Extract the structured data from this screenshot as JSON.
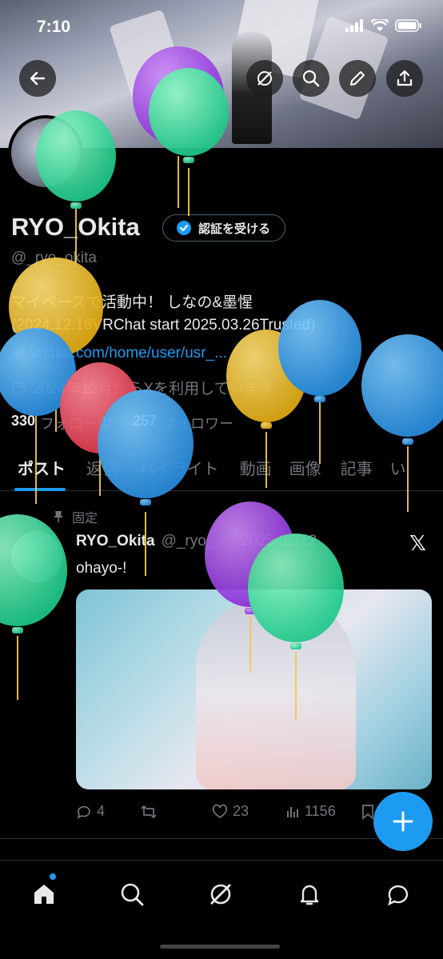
{
  "status_bar": {
    "time": "7:10"
  },
  "profile": {
    "display_name": "RYO_Okita",
    "verify_label": "認証を受ける",
    "handle": "@_ryo_okita",
    "bio_line1": "マイペースで活動中！ しなの&墨惺",
    "bio_line2": "(2024.12.16VRChat start 2025.03.26Trusted)",
    "link": "vrchat.com/home/user/usr_...",
    "joined": "2024年12月からXを利用しています",
    "following_count": "330",
    "following_label": "フォロー中",
    "followers_count": "257",
    "followers_label": "フォロワー"
  },
  "tabs": [
    "ポスト",
    "返信",
    "ハイライト",
    "動画",
    "画像",
    "記事",
    "い"
  ],
  "post": {
    "pinned_label": "固定",
    "author_name": "RYO_Okita",
    "author_meta": "@_ryo_... · 2025/02/12",
    "text": "ohayo-!",
    "replies": "4",
    "likes": "23",
    "views": "1156"
  },
  "colors": {
    "accent": "#1d9bf0",
    "background": "#000000",
    "text": "#e7e9ea",
    "muted": "#71767b"
  },
  "icons": {
    "back": "arrow-left-icon",
    "grok": "grok-icon",
    "search": "search-icon",
    "edit": "pencil-icon",
    "share": "share-icon",
    "nav": [
      "home-icon",
      "search-icon",
      "grok-icon",
      "bell-icon",
      "message-icon"
    ]
  }
}
